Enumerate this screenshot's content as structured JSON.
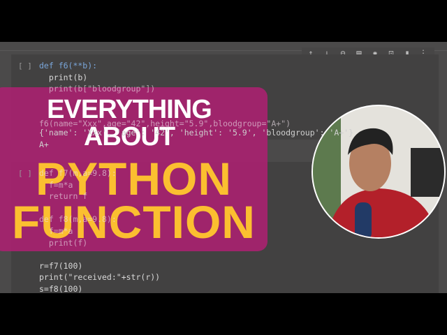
{
  "toolbar": {
    "icons": [
      "arrow-up-icon",
      "arrow-down-icon",
      "link-icon",
      "comment-icon",
      "settings-icon",
      "mirror-icon",
      "delete-icon",
      "more-icon"
    ]
  },
  "cell1": {
    "bracket": "[ ]",
    "lines": [
      "def f6(**b):",
      "  print(b)",
      "  print(b[\"bloodgroup\"])"
    ],
    "call": "f6(name=\"Xxx\",age=\"42\",height=\"5.9\",bloodgroup=\"A+\")",
    "output": [
      "{'name': 'Xxx', 'age': '42', 'height': '5.9', 'bloodgroup': 'A+'}",
      "A+"
    ]
  },
  "cell2": {
    "bracket": "[ ]",
    "lines": [
      "def f7(m,a=9.8):",
      "  f=m*a",
      "  return f",
      "",
      "def f8(m,a=9.8):",
      "  f=m*a",
      "  print(f)",
      "",
      "r=f7(100)",
      "print(\"received:\"+str(r))",
      "s=f8(100)"
    ]
  },
  "title": {
    "line1": "EVERYTHING",
    "line2": "ABOUT",
    "line3": "PYTHON",
    "line4": "FUNCTION"
  },
  "colors": {
    "banner": "#aa2170",
    "yellow": "#fbbf30"
  }
}
